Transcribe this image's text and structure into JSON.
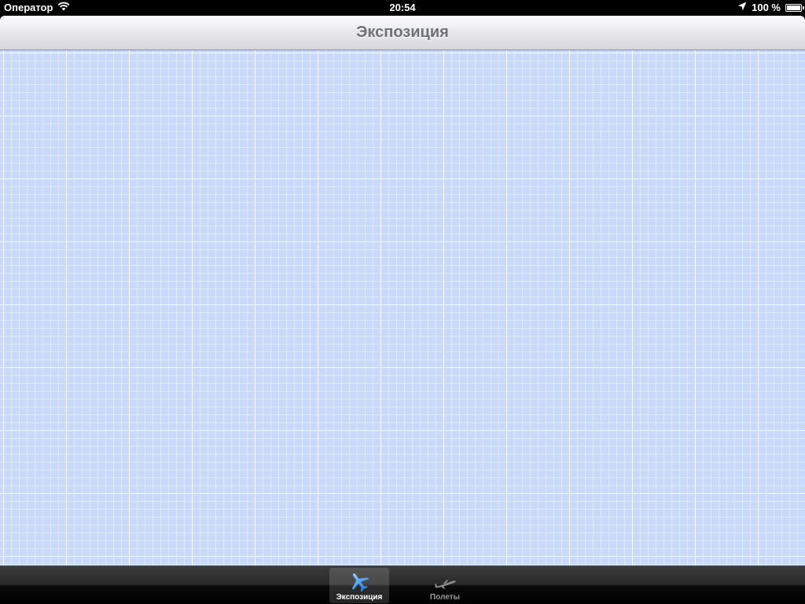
{
  "status_bar": {
    "carrier": "Оператор",
    "time": "20:54",
    "battery_text": "100 %",
    "battery_level": 1.0,
    "icons": [
      "wifi-icon",
      "location-arrow-icon",
      "battery-icon"
    ]
  },
  "nav_bar": {
    "title": "Экспозиция"
  },
  "tab_bar": {
    "selected_index": 0,
    "tabs": [
      {
        "label": "Экспозиция",
        "icon": "airplane-icon",
        "selected": true,
        "color": "#4aa3ff"
      },
      {
        "label": "Полеты",
        "icon": "airplane-takeoff-icon",
        "selected": false,
        "color": "#8e8e8e"
      }
    ]
  },
  "colors": {
    "content_background": "#c9d9fb",
    "grid_line": "#ffffff",
    "nav_title": "#6f7177",
    "tab_selected_icon": "#4aa3ff"
  }
}
